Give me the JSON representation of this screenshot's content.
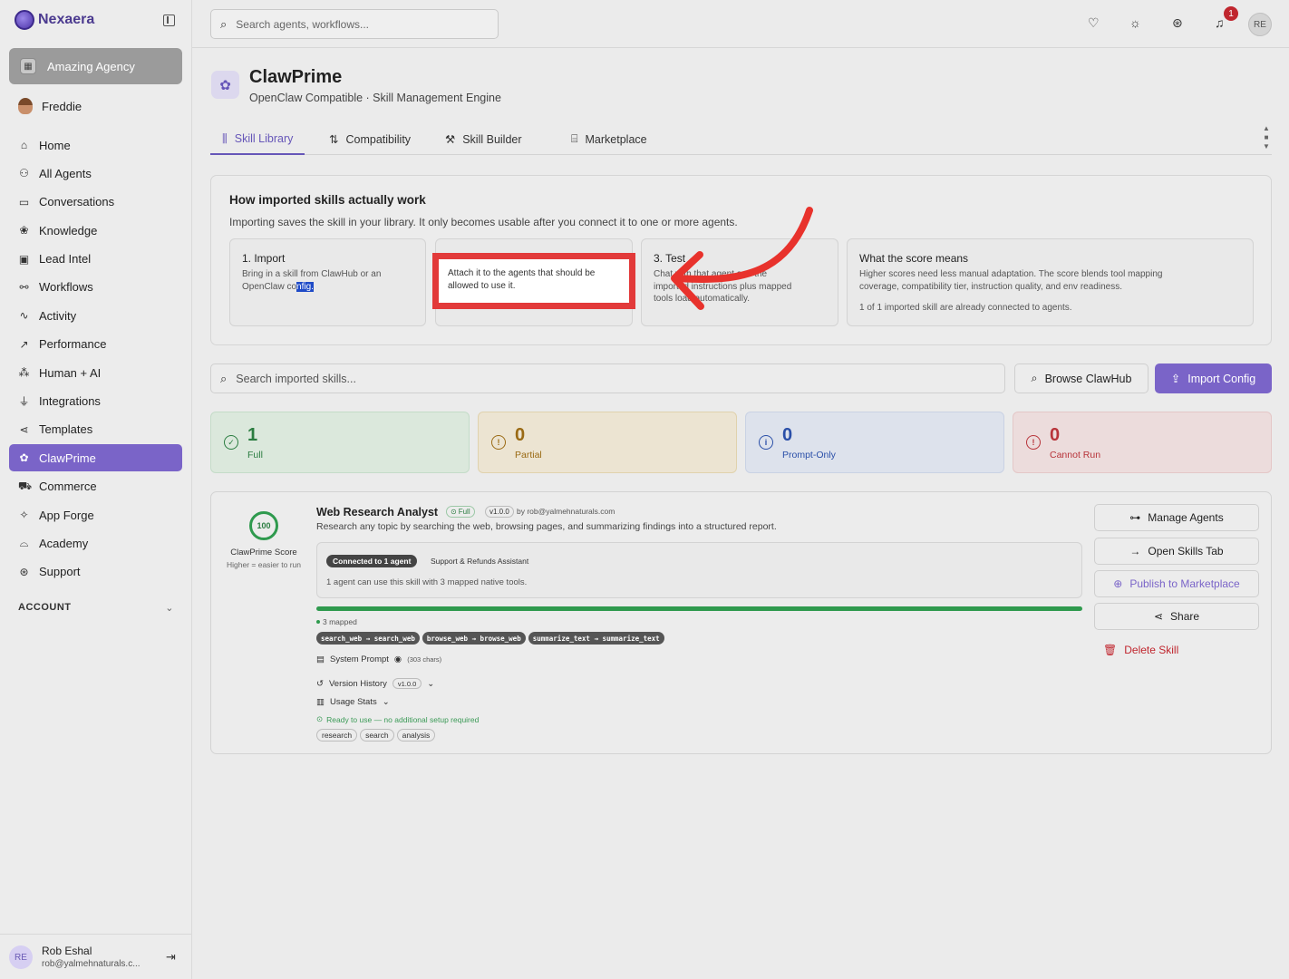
{
  "brand": {
    "name": "Nexaera"
  },
  "org": {
    "name": "Amazing Agency"
  },
  "current_user": {
    "name": "Freddie"
  },
  "sidebar": {
    "items": [
      {
        "label": "Home",
        "icon": "home-icon",
        "glyph": "⌂"
      },
      {
        "label": "All Agents",
        "icon": "bot-icon",
        "glyph": "⚇"
      },
      {
        "label": "Conversations",
        "icon": "chat-icon",
        "glyph": "▭"
      },
      {
        "label": "Knowledge",
        "icon": "brain-icon",
        "glyph": "❀"
      },
      {
        "label": "Lead Intel",
        "icon": "contact-icon",
        "glyph": "▣"
      },
      {
        "label": "Workflows",
        "icon": "workflow-icon",
        "glyph": "⚯"
      },
      {
        "label": "Activity",
        "icon": "activity-icon",
        "glyph": "∿"
      },
      {
        "label": "Performance",
        "icon": "trend-icon",
        "glyph": "↗"
      },
      {
        "label": "Human + AI",
        "icon": "people-icon",
        "glyph": "⁂"
      },
      {
        "label": "Integrations",
        "icon": "plug-icon",
        "glyph": "⏚"
      },
      {
        "label": "Templates",
        "icon": "share-nodes-icon",
        "glyph": "⋖"
      },
      {
        "label": "ClawPrime",
        "icon": "clawprime-icon",
        "glyph": "✿",
        "active": true
      },
      {
        "label": "Commerce",
        "icon": "cart-icon",
        "glyph": "⛟"
      },
      {
        "label": "App Forge",
        "icon": "sparkles-icon",
        "glyph": "✧"
      },
      {
        "label": "Academy",
        "icon": "graduation-icon",
        "glyph": "⌓"
      },
      {
        "label": "Support",
        "icon": "lifebuoy-icon",
        "glyph": "⊛"
      }
    ],
    "account_label": "ACCOUNT"
  },
  "footer_user": {
    "initials": "RE",
    "name": "Rob Eshal",
    "email": "rob@yalmehnaturals.c..."
  },
  "topbar": {
    "search_placeholder": "Search agents, workflows...",
    "notification_count": "1",
    "avatar_initials": "RE"
  },
  "page": {
    "title": "ClawPrime",
    "subtitle": "OpenClaw Compatible · Skill Management Engine"
  },
  "tabs": [
    {
      "label": "Skill Library",
      "icon": "library-icon",
      "glyph": "⫼",
      "active": true
    },
    {
      "label": "Compatibility",
      "icon": "git-compare-icon",
      "glyph": "⇅"
    },
    {
      "label": "Skill Builder",
      "icon": "wrench-icon",
      "glyph": "⚒"
    },
    {
      "label": "Marketplace",
      "icon": "store-icon",
      "glyph": "⌸"
    }
  ],
  "info": {
    "title": "How imported skills actually work",
    "lead": "Importing saves the skill in your library. It only becomes usable after you connect it to one or more agents.",
    "step1": {
      "title": "1. Import",
      "desc_a": "Bring in a skill from ClawHub or an",
      "desc_b": "OpenClaw co",
      "desc_sel": "nfig."
    },
    "step2": {
      "desc_a": "Attach it to the agents that should be",
      "desc_b": "allowed to use it."
    },
    "step3": {
      "title": "3. Test",
      "desc_a": "Chat with that agent and the",
      "desc_b": "imported instructions plus mapped",
      "desc_c": "tools load automatically."
    },
    "step4": {
      "title": "What the score means",
      "desc_a": "Higher scores need less manual adaptation. The score blends tool mapping",
      "desc_b": "coverage, compatibility tier, instruction quality, and env readiness.",
      "desc_c": "1 of 1 imported skill are already connected to agents."
    }
  },
  "skills_search": {
    "placeholder": "Search imported skills..."
  },
  "buttons": {
    "browse": "Browse ClawHub",
    "import": "Import Config"
  },
  "stats": [
    {
      "value": "1",
      "label": "Full",
      "icon": "check-circle-icon",
      "glyph": "✓",
      "color": "#2b7d41",
      "bg": "#dbe8dc",
      "border": "#c4dcc8"
    },
    {
      "value": "0",
      "label": "Partial",
      "icon": "warning-icon",
      "glyph": "!",
      "color": "#9a6a14",
      "bg": "#ece4d2",
      "border": "#e0d2ad"
    },
    {
      "value": "0",
      "label": "Prompt-Only",
      "icon": "info-icon",
      "glyph": "i",
      "color": "#2a4fa8",
      "bg": "#dde2ec",
      "border": "#c9d2e4"
    },
    {
      "value": "0",
      "label": "Cannot Run",
      "icon": "alert-circle-icon",
      "glyph": "!",
      "color": "#b8343a",
      "bg": "#ecdcdc",
      "border": "#e4c7c7"
    }
  ],
  "skill": {
    "score": "100",
    "score_label": "ClawPrime Score",
    "score_sub": "Higher = easier to run",
    "name": "Web Research Analyst",
    "tier": "Full",
    "version": "v1.0.0",
    "author": "by rob@yalmehnaturals.com",
    "description": "Research any topic by searching the web, browsing pages, and summarizing findings into a structured report.",
    "connected_badge": "Connected to 1 agent",
    "connected_agent": "Support & Refunds Assistant",
    "connected_desc": "1 agent can use this skill with 3 mapped native tools.",
    "mapped_label": "3 mapped",
    "progress": 1.0,
    "mappings": [
      "search_web → search_web",
      "browse_web → browse_web",
      "summarize_text → summarize_text"
    ],
    "system_prompt_label": "System Prompt",
    "system_prompt_chars": "(303 chars)",
    "version_history_label": "Version History",
    "version_history_value": "v1.0.0",
    "usage_stats_label": "Usage Stats",
    "ready_text": "Ready to use — no additional setup required",
    "tags": [
      "research",
      "search",
      "analysis"
    ]
  },
  "actions": {
    "manage_agents": "Manage Agents",
    "open_skills_tab": "Open Skills Tab",
    "publish": "Publish to Marketplace",
    "share": "Share",
    "delete": "Delete Skill"
  }
}
